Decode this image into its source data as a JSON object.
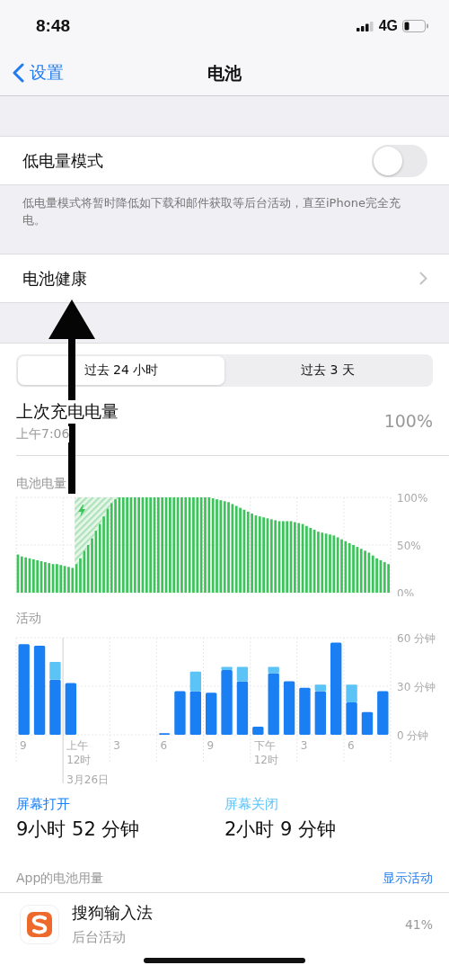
{
  "status_bar": {
    "time": "8:48",
    "network": "4G"
  },
  "nav": {
    "back": "设置",
    "title": "电池"
  },
  "low_power_mode": {
    "label": "低电量模式",
    "on": false,
    "footer": "低电量模式将暂时降低如下载和邮件获取等后台活动，直至iPhone完全充电。"
  },
  "battery_health": {
    "label": "电池健康"
  },
  "tabs": [
    {
      "label": "过去 24 小时",
      "selected": true
    },
    {
      "label": "过去 3 天",
      "selected": false
    }
  ],
  "last_charge": {
    "label": "上次充电电量",
    "time": "上午7:06",
    "value": "100%"
  },
  "battery_chart": {
    "chart_data": {
      "type": "bar",
      "title": "电池电量",
      "ylim": [
        0,
        100
      ],
      "yticks": [
        {
          "value": 0,
          "label": "0%"
        },
        {
          "value": 50,
          "label": "50%"
        },
        {
          "value": 100,
          "label": "100%"
        }
      ],
      "values": [
        40,
        38,
        37,
        36,
        35,
        34,
        33,
        32,
        31,
        30,
        30,
        29,
        28,
        27,
        26,
        30,
        36,
        44,
        50,
        57,
        65,
        72,
        80,
        88,
        94,
        98,
        100,
        100,
        100,
        100,
        100,
        100,
        100,
        100,
        100,
        100,
        100,
        100,
        100,
        100,
        100,
        100,
        100,
        100,
        100,
        100,
        100,
        100,
        100,
        100,
        99,
        98,
        97,
        96,
        95,
        93,
        91,
        89,
        87,
        85,
        83,
        81,
        80,
        79,
        78,
        77,
        76,
        75,
        75,
        75,
        75,
        74,
        73,
        72,
        70,
        68,
        66,
        64,
        63,
        62,
        61,
        60,
        58,
        56,
        54,
        52,
        50,
        48,
        46,
        44,
        42,
        39,
        36,
        34,
        32,
        30
      ]
    }
  },
  "activity_chart": {
    "chart_data": {
      "type": "bar",
      "title": "活动",
      "stacked": true,
      "ylim": [
        0,
        60
      ],
      "yticks": [
        {
          "value": 0,
          "label": "0 分钟"
        },
        {
          "value": 30,
          "label": "30 分钟"
        },
        {
          "value": 60,
          "label": "60 分钟"
        }
      ],
      "categories": [
        "9",
        null,
        null,
        "上午12时",
        null,
        null,
        "3",
        null,
        null,
        "6",
        null,
        null,
        "9",
        null,
        null,
        "下午12时",
        null,
        null,
        "3",
        null,
        null,
        "6",
        null,
        null
      ],
      "series": [
        {
          "name": "屏幕打开",
          "color": "#1a7ff2",
          "values": [
            56,
            55,
            34,
            32,
            0,
            0,
            0,
            0,
            0,
            1,
            27,
            27,
            26,
            40,
            33,
            5,
            38,
            33,
            29,
            27,
            57,
            20,
            14,
            27
          ]
        },
        {
          "name": "屏幕关闭",
          "color": "#5cc3f7",
          "values": [
            0,
            0,
            11,
            0,
            0,
            0,
            0,
            0,
            0,
            0,
            0,
            12,
            0,
            2,
            9,
            0,
            4,
            0,
            0,
            4,
            0,
            11,
            0,
            0
          ]
        }
      ]
    },
    "date": "3月26日"
  },
  "screen_on": {
    "value": "9小时 52 分钟"
  },
  "screen_off": {
    "value": "2小时 9 分钟"
  },
  "app_usage": {
    "header": "App的电池用量",
    "action": "显示活动",
    "apps": [
      {
        "name": "搜狗输入法",
        "detail": "后台活动",
        "value": "41%"
      }
    ]
  }
}
